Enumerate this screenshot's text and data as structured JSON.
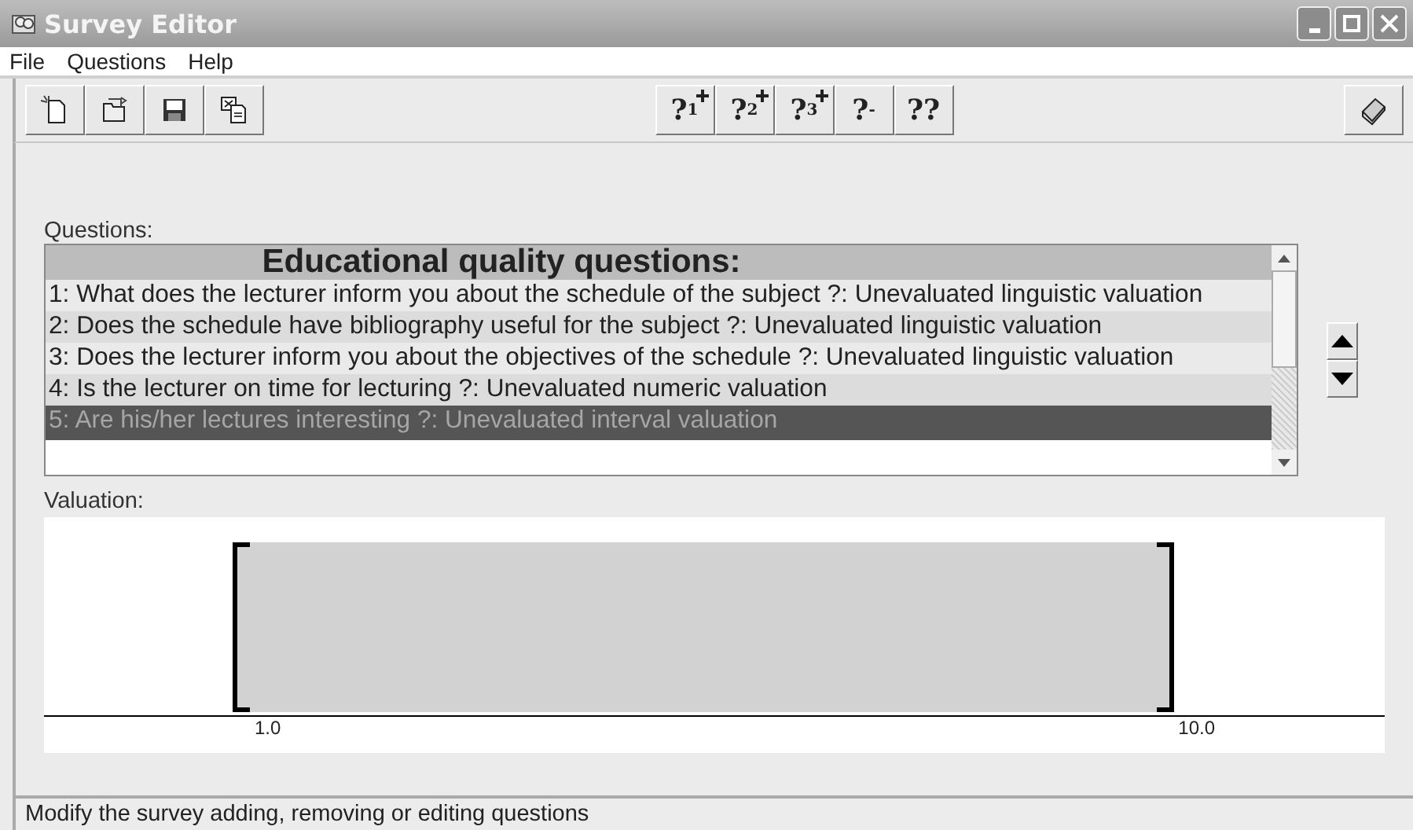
{
  "window": {
    "title": "Survey Editor"
  },
  "menu": [
    "File",
    "Questions",
    "Help"
  ],
  "file_tools": [
    {
      "kind": "new"
    },
    {
      "kind": "open"
    },
    {
      "kind": "save"
    },
    {
      "kind": "export"
    }
  ],
  "question_tools": [
    {
      "kind": "add",
      "glyph": "?",
      "mark": "1"
    },
    {
      "kind": "add",
      "glyph": "?",
      "mark": "2"
    },
    {
      "kind": "add",
      "glyph": "?",
      "mark": "3"
    },
    {
      "kind": "remove",
      "glyph": "?",
      "mark": "-"
    },
    {
      "kind": "replace",
      "glyph": "??"
    }
  ],
  "questions": {
    "label": "Questions:",
    "heading": "Educational quality questions:",
    "items": [
      {
        "text": "1: What does the lecturer inform you about the schedule of the subject ?: Unevaluated linguistic valuation",
        "selected": false
      },
      {
        "text": "2: Does the schedule have bibliography useful for the subject ?: Unevaluated linguistic valuation",
        "selected": false
      },
      {
        "text": "3: Does the lecturer inform you about the objectives of the schedule ?: Unevaluated linguistic valuation",
        "selected": false
      },
      {
        "text": "4: Is the lecturer on time for lecturing ?: Unevaluated numeric valuation",
        "selected": false
      },
      {
        "text": "5: Are his/her lectures interesting ?: Unevaluated interval valuation",
        "selected": true
      }
    ]
  },
  "valuation": {
    "label": "Valuation:",
    "kind": "interval",
    "min_label": "1.0",
    "max_label": "10.0"
  },
  "status_bar": "Modify the survey adding, removing or editing questions"
}
